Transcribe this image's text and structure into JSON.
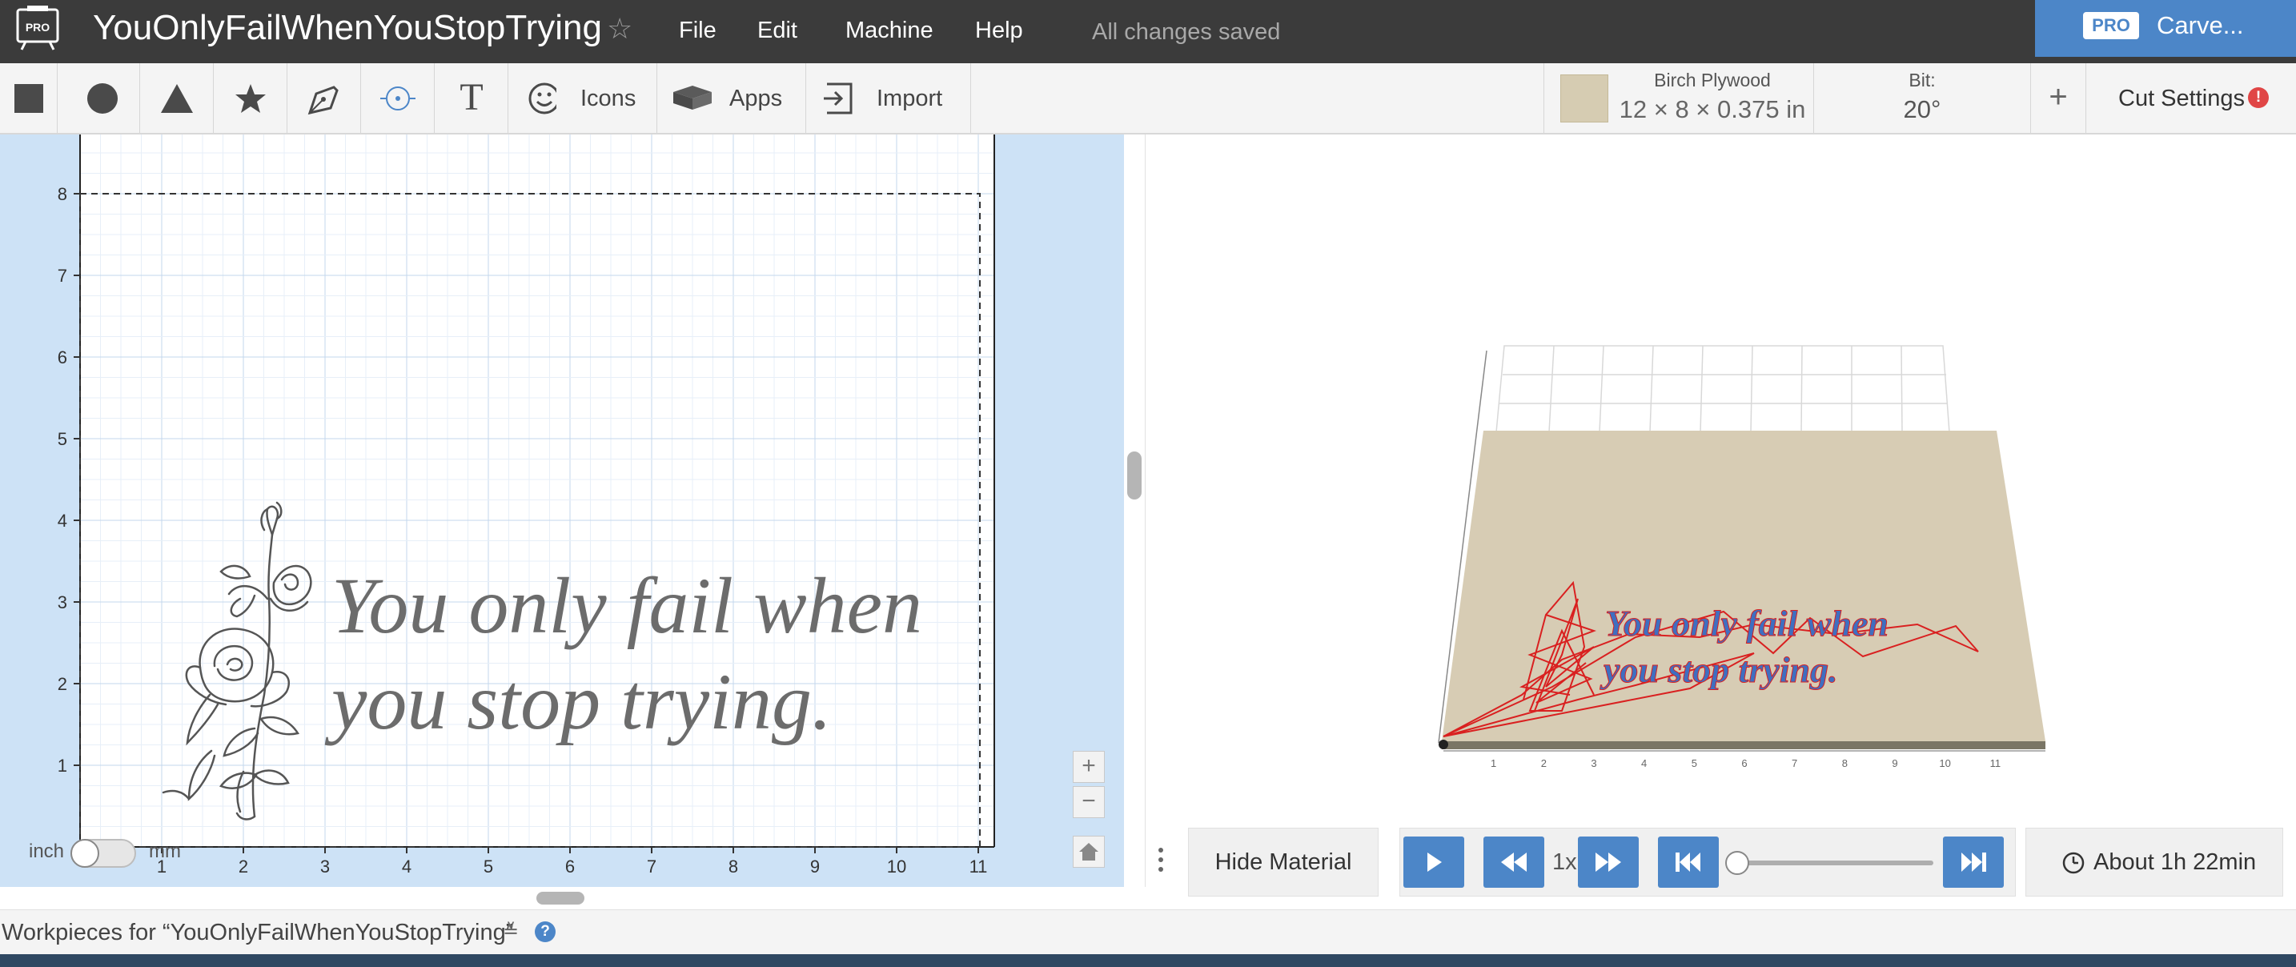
{
  "app": {
    "logo_badge": "PRO",
    "title": "YouOnlyFailWhenYouStopTrying",
    "menu": [
      "File",
      "Edit",
      "Machine",
      "Help"
    ],
    "status": "All changes saved",
    "carve_button": {
      "badge": "PRO",
      "label": "Carve..."
    }
  },
  "toolbar": {
    "shape_tools": [
      "square-icon",
      "circle-icon",
      "triangle-icon",
      "star-icon",
      "pen-icon",
      "target-icon",
      "text-icon"
    ],
    "text_tool_glyph": "T",
    "icons_label": "Icons",
    "apps_label": "Apps",
    "import_label": "Import",
    "material": {
      "name": "Birch Plywood",
      "size": "12 × 8 × 0.375 in",
      "swatch_color": "#d6ccb2"
    },
    "bit": {
      "label": "Bit:",
      "value": "20°"
    },
    "add_symbol": "+",
    "cut_settings_label": "Cut Settings",
    "cut_settings_warning": "!"
  },
  "canvas": {
    "x_ticks": [
      "1",
      "2",
      "3",
      "4",
      "5",
      "6",
      "7",
      "8",
      "9",
      "10",
      "11"
    ],
    "y_ticks": [
      "1",
      "2",
      "3",
      "4",
      "5",
      "6",
      "7",
      "8"
    ],
    "design_text_line1": "You only fail when",
    "design_text_line2": "you stop trying.",
    "unit_left": "inch",
    "unit_right": "mm",
    "zoom_in": "+",
    "zoom_out": "−"
  },
  "preview": {
    "carved_text_line1": "You only fail when",
    "carved_text_line2": "you stop trying.",
    "x_ticks": [
      "1",
      "2",
      "3",
      "4",
      "5",
      "6",
      "7",
      "8",
      "9",
      "10",
      "11"
    ],
    "hide_material_label": "Hide Material",
    "speed_label": "1x",
    "progress": 0,
    "estimate_label": "About 1h 22min"
  },
  "colors": {
    "accent": "#4c86c8",
    "titlebar": "#3b3b3b",
    "canvas_bg": "#cde2f6",
    "toolpath": "#d92020",
    "material": "#d6ccb2"
  },
  "footer": {
    "workpieces_label": "Workpieces for “YouOnlyFailWhenYouStopTrying”",
    "chevron": "≚",
    "help_glyph": "?"
  }
}
